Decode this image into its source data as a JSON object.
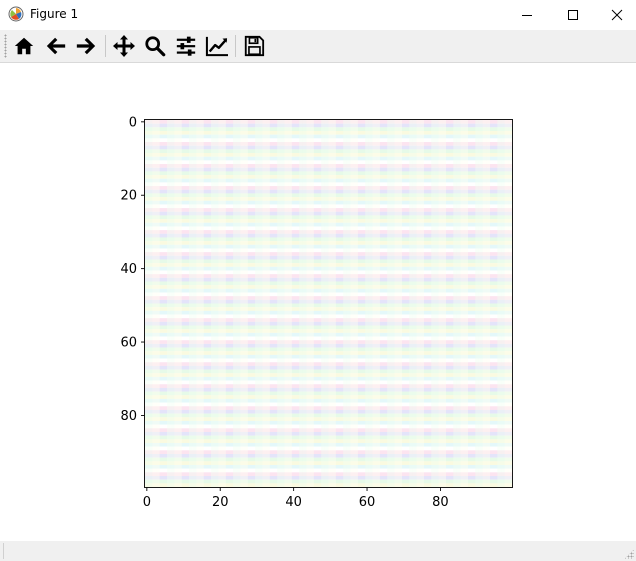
{
  "window": {
    "title": "Figure 1",
    "icons": {
      "app": "matplotlib-icon",
      "minimize": "minimize-icon",
      "maximize": "maximize-icon",
      "close": "close-icon"
    }
  },
  "toolbar": {
    "tools": [
      {
        "name": "home",
        "icon": "home-icon"
      },
      {
        "name": "back",
        "icon": "arrow-left-icon"
      },
      {
        "name": "forward",
        "icon": "arrow-right-icon"
      },
      {
        "name": "pan",
        "icon": "move-icon"
      },
      {
        "name": "zoom",
        "icon": "magnifier-icon"
      },
      {
        "name": "subplots",
        "icon": "sliders-icon"
      },
      {
        "name": "edit-axes",
        "icon": "line-chart-icon"
      },
      {
        "name": "save",
        "icon": "floppy-disk-icon"
      }
    ]
  },
  "chart_data": {
    "type": "heatmap",
    "title": "",
    "xlabel": "",
    "ylabel": "",
    "x_ticks": [
      "0",
      "20",
      "40",
      "60",
      "80"
    ],
    "y_ticks": [
      "0",
      "20",
      "40",
      "60",
      "80"
    ],
    "xlim": [
      -0.5,
      99.5
    ],
    "ylim": [
      99.5,
      -0.5
    ],
    "shape": [
      100,
      100
    ],
    "row_pattern_colors": [
      "#fce4f0",
      "#e4e4fa",
      "#e6fae8",
      "#fafae0",
      "#e4f8fa",
      "#ffffff"
    ],
    "column_tint_colors": [
      "#f2fff2",
      "#fffff2",
      "#ffffff"
    ]
  }
}
